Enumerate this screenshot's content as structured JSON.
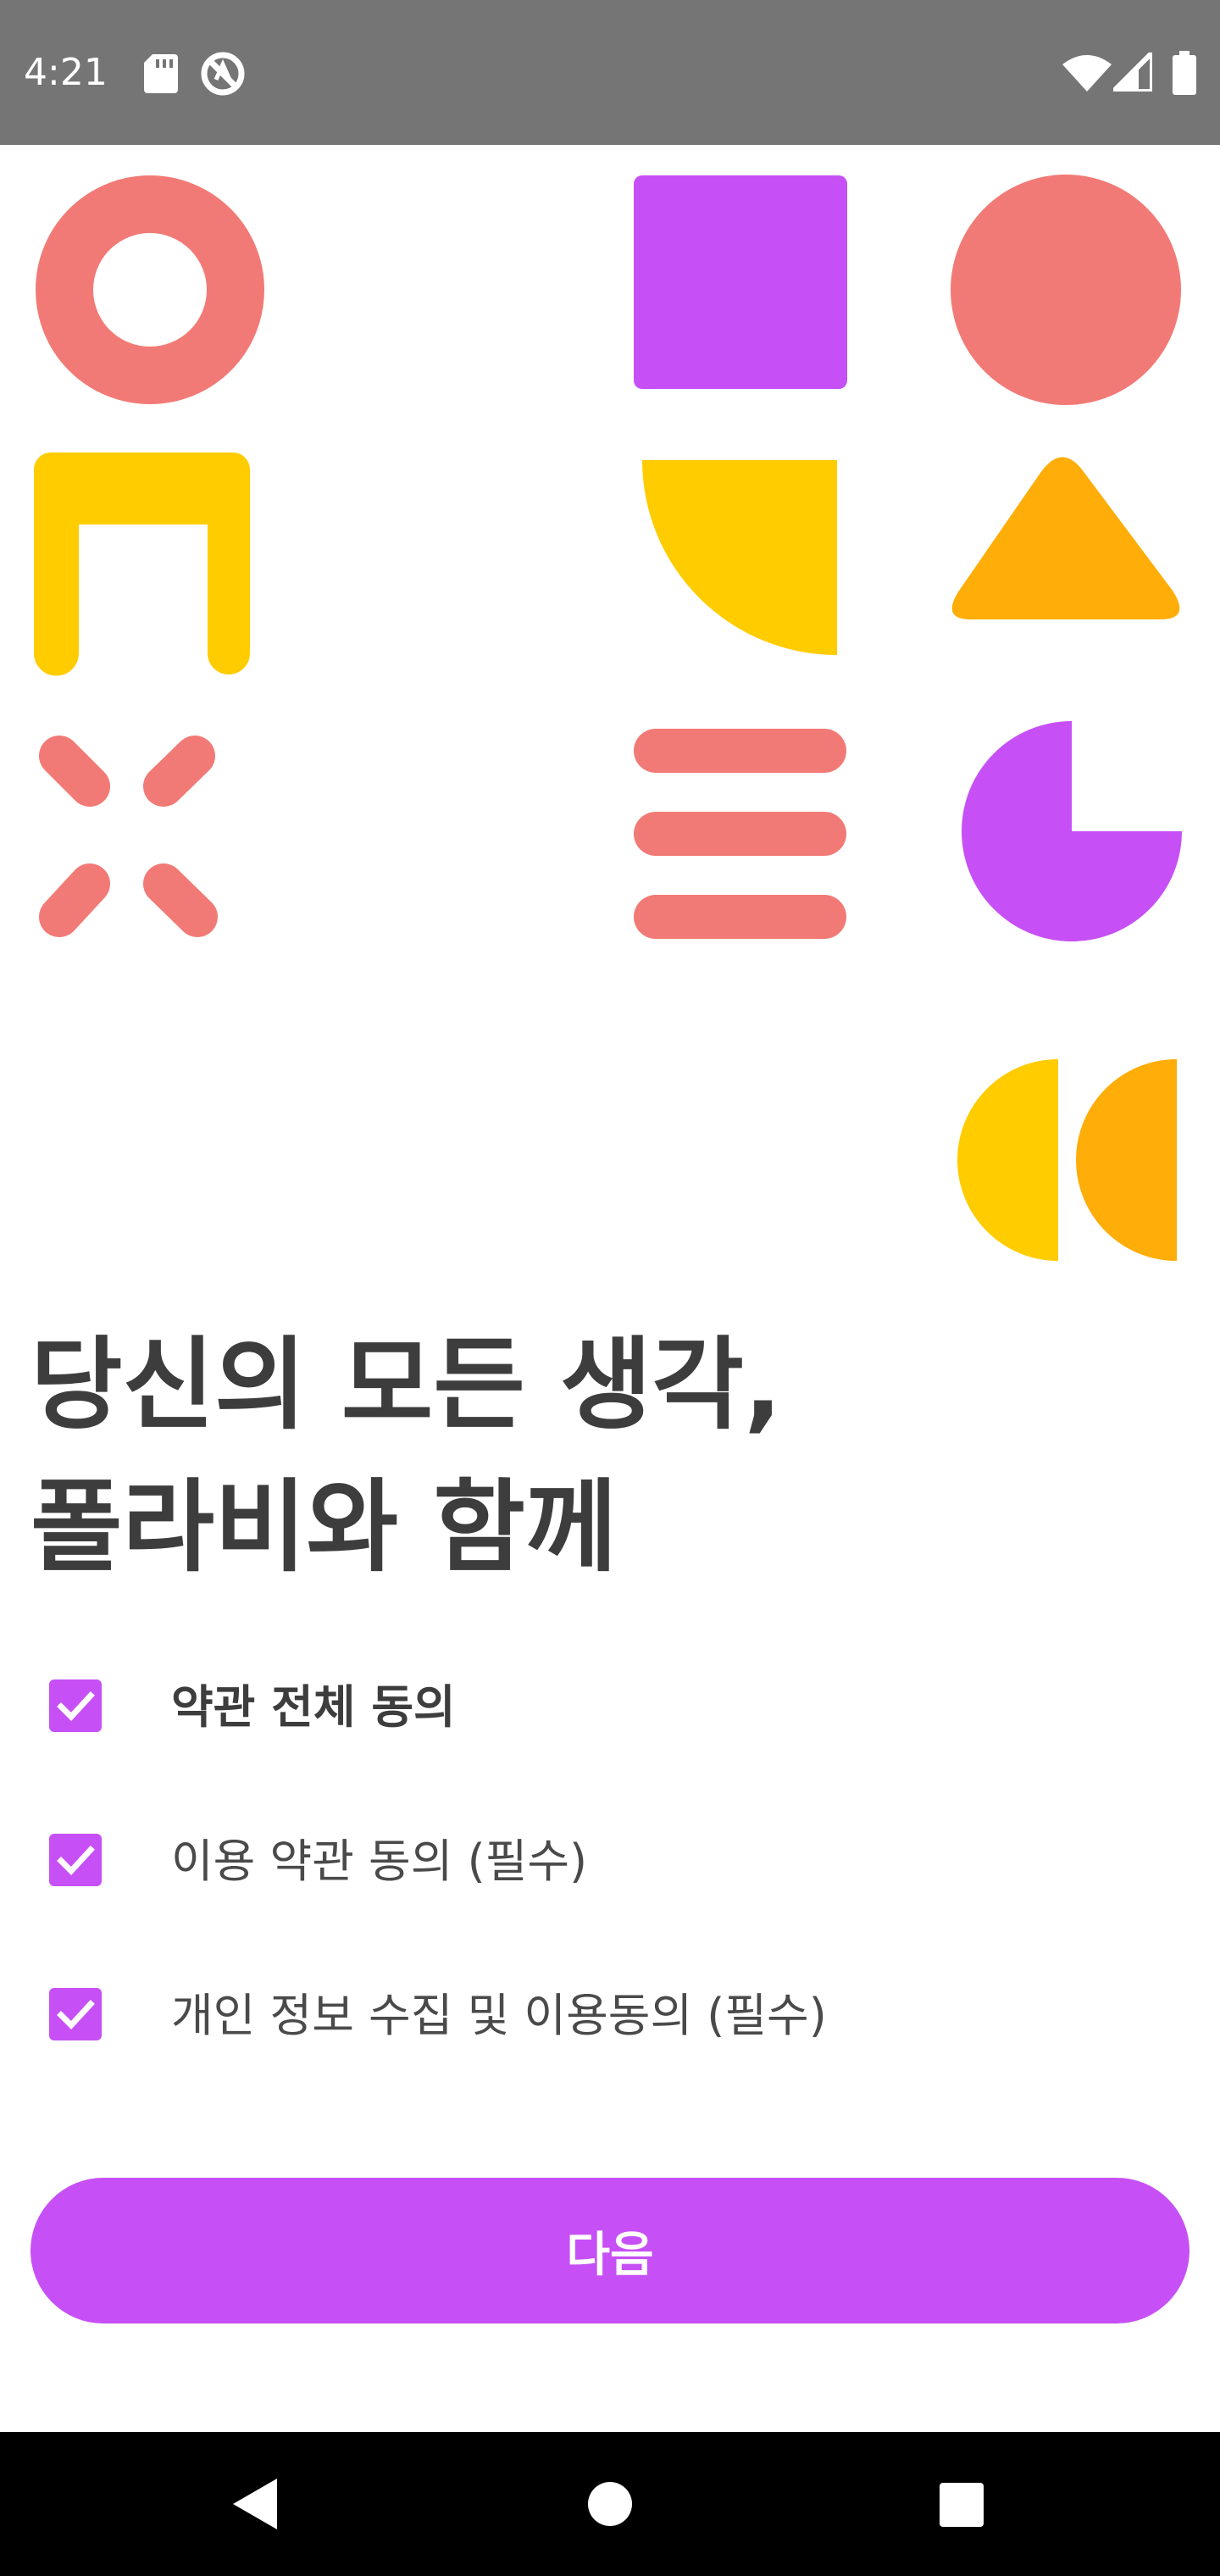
{
  "status_bar": {
    "time": "4:21",
    "icons": [
      "sd-card-icon",
      "do-not-disturb-icon",
      "wifi-icon",
      "cellular-signal-icon",
      "battery-icon"
    ]
  },
  "illustration": {
    "colors": {
      "coral": "#f27a76",
      "purple": "#c650f5",
      "yellow": "#ffcc00",
      "orange": "#ffad09"
    }
  },
  "headline": {
    "line1": "당신의 모든 생각,",
    "line2": "폴라비와 함께"
  },
  "agreements": [
    {
      "label": "약관 전체 동의",
      "checked": true,
      "bold": true
    },
    {
      "label": "이용 약관 동의 (필수)",
      "checked": true,
      "bold": false
    },
    {
      "label": "개인 정보 수집 및 이용동의 (필수)",
      "checked": true,
      "bold": false
    }
  ],
  "next_button": {
    "label": "다음"
  },
  "navigation_bar": {
    "icons": [
      "back-icon",
      "home-icon",
      "recents-icon"
    ]
  },
  "colors": {
    "accent": "#c650f5",
    "status_bar": "#757575",
    "text": "#3d3d3d"
  }
}
